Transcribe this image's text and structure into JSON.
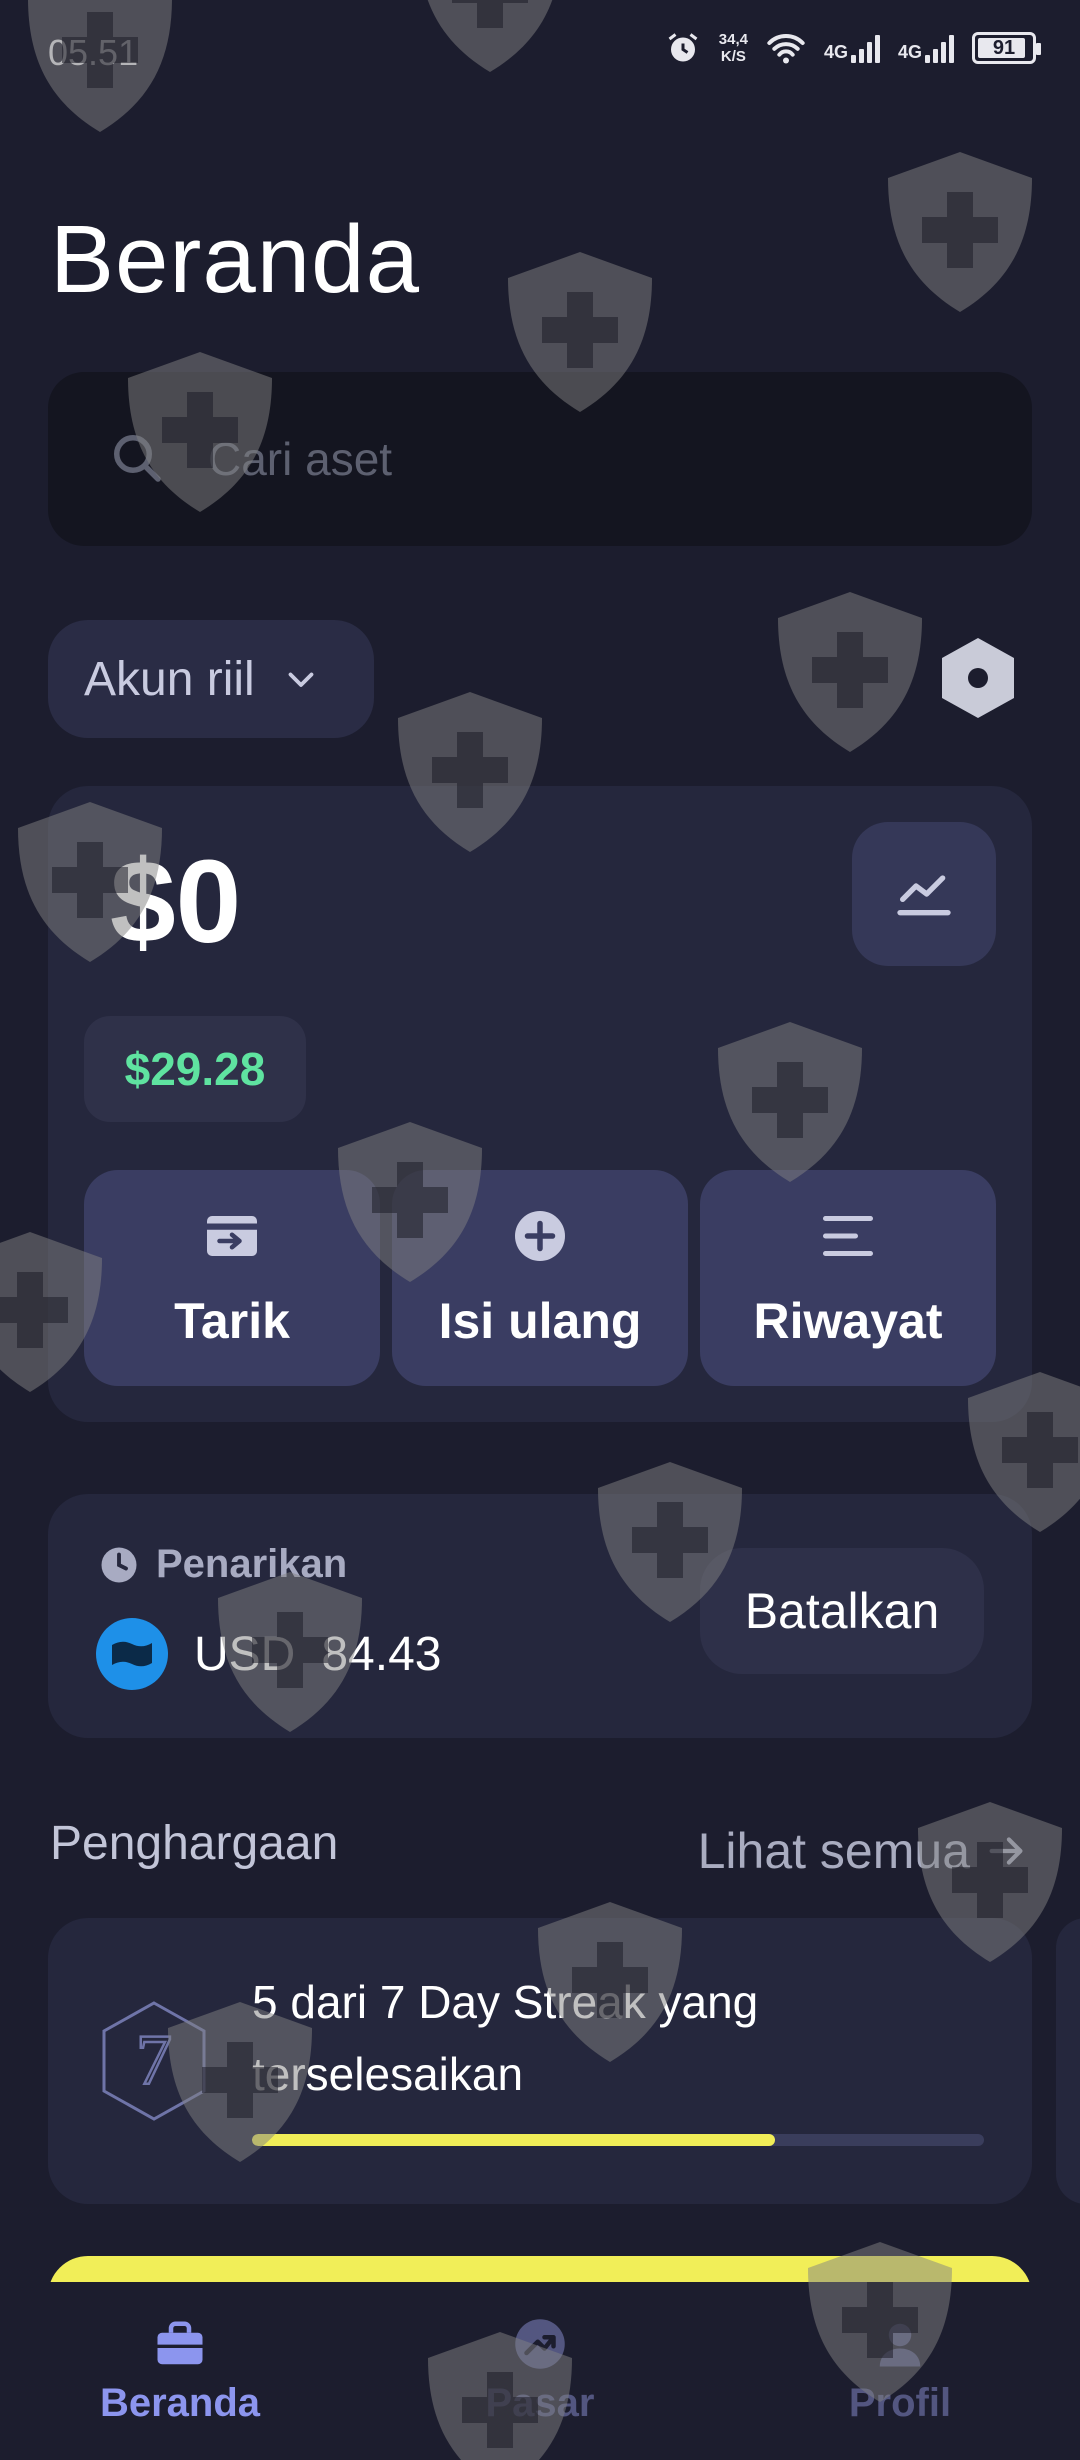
{
  "status_bar": {
    "time": "05.51",
    "speed_value": "34,4",
    "speed_unit": "K/S",
    "network_1": "4G",
    "network_2": "4G",
    "battery": "91"
  },
  "page_title": "Beranda",
  "search": {
    "placeholder": "Cari aset"
  },
  "account_selector": {
    "label": "Akun riil"
  },
  "balance": {
    "amount": "$0",
    "secondary": "$29.28",
    "actions": [
      "Tarik",
      "Isi ulang",
      "Riwayat"
    ]
  },
  "withdrawal": {
    "label": "Penarikan",
    "currency": "USD",
    "amount": "84.43",
    "cancel_label": "Batalkan"
  },
  "awards": {
    "title": "Penghargaan",
    "see_all": "Lihat semua",
    "card_text": "5 dari 7 Day Streak yang terselesaikan",
    "badge_number": "7",
    "progress": 0.714
  },
  "bottom_nav": {
    "items": [
      "Beranda",
      "Pasar",
      "Profil"
    ]
  },
  "colors": {
    "background": "#1c1d2e",
    "card": "#25273d",
    "accent": "#8c95ee",
    "green": "#5fe3a0",
    "yellow": "#f1ee58"
  }
}
